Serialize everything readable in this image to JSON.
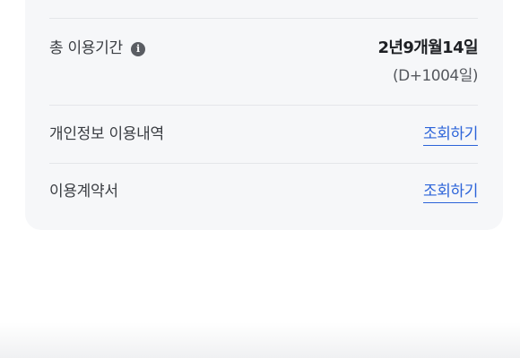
{
  "usage_period": {
    "label": "총 이용기간",
    "info_icon": "info-icon",
    "value": "2년9개월14일",
    "sub_value": "(D+1004일)"
  },
  "privacy_usage": {
    "label": "개인정보 이용내역",
    "link": "조회하기"
  },
  "contract": {
    "label": "이용계약서",
    "link": "조회하기"
  },
  "colors": {
    "card_bg": "#f6f7f9",
    "link": "#2b63d9",
    "divider": "#e4e6ea"
  }
}
